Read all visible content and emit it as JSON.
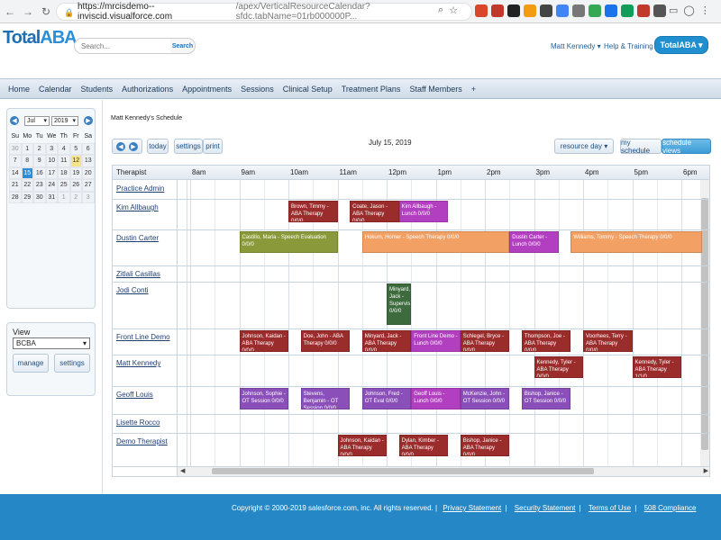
{
  "browser": {
    "url_host": "https://mrcisdemo--inviscid.visualforce.com",
    "url_path": "/apex/VerticalResourceCalendar?sfdc.tabName=01rb000000P..."
  },
  "header": {
    "logo_main": "Total",
    "logo_accent": "ABA",
    "search_placeholder": "Search...",
    "search_button": "Search",
    "user_menu": "Matt Kennedy ▾",
    "help_link": "Help & Training",
    "app_switcher": "TotalABA ▾"
  },
  "tabs": [
    "Home",
    "Calendar",
    "Students",
    "Authorizations",
    "Appointments",
    "Sessions",
    "Clinical Setup",
    "Treatment Plans",
    "Staff Members",
    "+"
  ],
  "mini_calendar": {
    "month": "Jul",
    "year": "2019",
    "dow": [
      "Su",
      "Mo",
      "Tu",
      "We",
      "Th",
      "Fr",
      "Sa"
    ],
    "weeks": [
      [
        {
          "d": "30",
          "o": true
        },
        {
          "d": "1"
        },
        {
          "d": "2"
        },
        {
          "d": "3"
        },
        {
          "d": "4"
        },
        {
          "d": "5"
        },
        {
          "d": "6"
        }
      ],
      [
        {
          "d": "7"
        },
        {
          "d": "8"
        },
        {
          "d": "9"
        },
        {
          "d": "10"
        },
        {
          "d": "11"
        },
        {
          "d": "12",
          "today": true
        },
        {
          "d": "13"
        }
      ],
      [
        {
          "d": "14"
        },
        {
          "d": "15",
          "sel": true
        },
        {
          "d": "16"
        },
        {
          "d": "17"
        },
        {
          "d": "18"
        },
        {
          "d": "19"
        },
        {
          "d": "20"
        }
      ],
      [
        {
          "d": "21"
        },
        {
          "d": "22"
        },
        {
          "d": "23"
        },
        {
          "d": "24"
        },
        {
          "d": "25"
        },
        {
          "d": "26"
        },
        {
          "d": "27"
        }
      ],
      [
        {
          "d": "28"
        },
        {
          "d": "29"
        },
        {
          "d": "30"
        },
        {
          "d": "31"
        },
        {
          "d": "1",
          "o": true
        },
        {
          "d": "2",
          "o": true
        },
        {
          "d": "3",
          "o": true
        }
      ]
    ]
  },
  "view": {
    "label": "View",
    "selected": "BCBA",
    "manage_button": "manage",
    "settings_button": "settings"
  },
  "schedule": {
    "title": "Matt Kennedy's Schedule",
    "date": "July 15, 2019",
    "today_button": "today",
    "settings_button": "settings",
    "print_button": "print",
    "resource_day": "resource day ▾",
    "my_schedule": "my schedule",
    "schedule_views": "schedule views",
    "therapist_header": "Therapist",
    "hours": [
      "8am",
      "9am",
      "10am",
      "11am",
      "12pm",
      "1pm",
      "2pm",
      "3pm",
      "4pm",
      "5pm",
      "6pm"
    ],
    "therapists": [
      "Practice Admin",
      "Kim Allbaugh",
      "Dustin Carter",
      "Zitlali Casillas",
      "Jodi Conti",
      "Front Line Demo",
      "Matt Kennedy",
      "Geoff Louis",
      "Lisette Rocco",
      "Demo Therapist"
    ],
    "colors": {
      "maroon": "#9b2c2c",
      "magenta": "#b23fbf",
      "olive": "#8a9a3a",
      "orange": "#f2a064",
      "green": "#3d6b3d",
      "purple": "#8a4fb8"
    },
    "events": [
      {
        "row": 1,
        "start": 10.0,
        "end": 11.0,
        "color": "maroon",
        "text": "Brown, Timmy - ABA Therapy 0/0/0"
      },
      {
        "row": 1,
        "start": 11.25,
        "end": 12.25,
        "color": "maroon",
        "text": "Coate, Jason - ABA Therapy 0/0/0"
      },
      {
        "row": 1,
        "start": 12.25,
        "end": 13.25,
        "color": "magenta",
        "text": "Kim Allbaugh - Lunch 0/0/0"
      },
      {
        "row": 2,
        "start": 9.0,
        "end": 11.0,
        "color": "olive",
        "text": "Castillo, Maria - Speech Evaluation 0/0/0"
      },
      {
        "row": 2,
        "start": 11.5,
        "end": 14.5,
        "color": "orange",
        "text": "Hokum, Homer - Speech Therapy 0/0/0"
      },
      {
        "row": 2,
        "start": 14.5,
        "end": 15.5,
        "color": "magenta",
        "text": "Dustin Carter - Lunch 0/0/0"
      },
      {
        "row": 2,
        "start": 15.75,
        "end": 18.5,
        "color": "orange",
        "text": "Williams, Tommy - Speech Therapy 0/0/0"
      },
      {
        "row": 4,
        "start": 12.0,
        "end": 12.5,
        "color": "green",
        "text": "Minyard, Jack - Supervisio 0/0/0"
      },
      {
        "row": 5,
        "start": 9.0,
        "end": 10.0,
        "color": "maroon",
        "text": "Johnson, Kaidan - ABA Therapy 0/0/0"
      },
      {
        "row": 5,
        "start": 10.25,
        "end": 11.25,
        "color": "maroon",
        "text": "Doe, John - ABA Therapy 0/0/0"
      },
      {
        "row": 5,
        "start": 11.5,
        "end": 12.5,
        "color": "maroon",
        "text": "Minyard, Jack - ABA Therapy 0/0/0"
      },
      {
        "row": 5,
        "start": 12.5,
        "end": 13.5,
        "color": "magenta",
        "text": "Front Line Demo - Lunch 0/0/0"
      },
      {
        "row": 5,
        "start": 13.5,
        "end": 14.5,
        "color": "maroon",
        "text": "Schlegel, Bryce - ABA Therapy 0/0/0"
      },
      {
        "row": 5,
        "start": 14.75,
        "end": 15.75,
        "color": "maroon",
        "text": "Thompson, Joe - ABA Therapy 0/0/0"
      },
      {
        "row": 5,
        "start": 16.0,
        "end": 17.0,
        "color": "maroon",
        "text": "Voorhees, Terry - ABA Therapy 0/0/0"
      },
      {
        "row": 6,
        "start": 15.0,
        "end": 16.0,
        "color": "maroon",
        "text": "Kennedy, Tyler - ABA Therapy 0/0/0"
      },
      {
        "row": 6,
        "start": 17.0,
        "end": 18.0,
        "color": "maroon",
        "text": "Kennedy, Tyler - ABA Therapy 1/1/0"
      },
      {
        "row": 7,
        "start": 9.0,
        "end": 10.0,
        "color": "purple",
        "text": "Johnson, Sophie - OT Session 0/0/0"
      },
      {
        "row": 7,
        "start": 10.25,
        "end": 11.25,
        "color": "purple",
        "text": "Stevens, Benjamin - OT Session 0/0/0"
      },
      {
        "row": 7,
        "start": 11.5,
        "end": 12.5,
        "color": "purple",
        "text": "Johnson, Fred - OT Eval 0/0/0"
      },
      {
        "row": 7,
        "start": 12.5,
        "end": 13.5,
        "color": "magenta",
        "text": "Geoff Louis - Lunch 0/0/0"
      },
      {
        "row": 7,
        "start": 13.5,
        "end": 14.5,
        "color": "purple",
        "text": "McKenzie, John - OT Session 0/0/0"
      },
      {
        "row": 7,
        "start": 14.75,
        "end": 15.75,
        "color": "purple",
        "text": "Bishop, Janice - OT Session 0/0/0"
      },
      {
        "row": 9,
        "start": 11.0,
        "end": 12.0,
        "color": "maroon",
        "text": "Johnson, Kaidan - ABA Therapy 0/0/0"
      },
      {
        "row": 9,
        "start": 12.25,
        "end": 13.25,
        "color": "maroon",
        "text": "Dylan, Kimber - ABA Therapy 0/0/0"
      },
      {
        "row": 9,
        "start": 13.5,
        "end": 14.5,
        "color": "maroon",
        "text": "Bishop, Janice - ABA Therapy 0/0/0"
      }
    ]
  },
  "footer": {
    "copyright": "Copyright © 2000-2019 salesforce.com, inc. All rights reserved. |",
    "links": [
      "Privacy Statement",
      "Security Statement",
      "Terms of Use",
      "508 Compliance"
    ]
  }
}
